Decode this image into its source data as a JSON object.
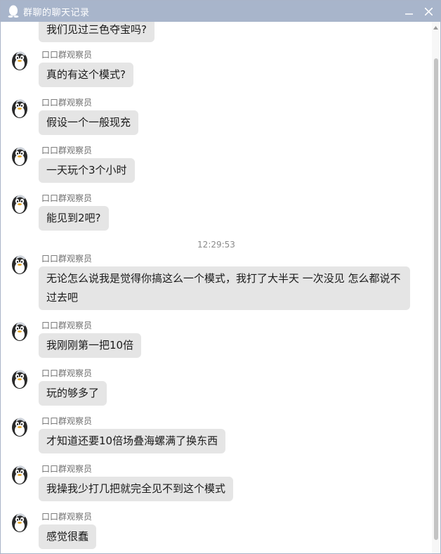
{
  "window": {
    "title": "群聊的聊天记录",
    "minimize_icon": "minimize-icon",
    "close_icon": "close-icon",
    "app_icon": "penguin-icon"
  },
  "chat": {
    "top_partial_message": "我们见过三色夺宝吗?",
    "timestamp": "12:29:53",
    "messages_before_timestamp": [
      {
        "sender": "口口群观察员",
        "text": "真的有这个模式?"
      },
      {
        "sender": "口口群观察员",
        "text": "假设一个一般现充"
      },
      {
        "sender": "口口群观察员",
        "text": "一天玩个3个小时"
      },
      {
        "sender": "口口群观察员",
        "text": "能见到2吧?"
      }
    ],
    "messages_after_timestamp": [
      {
        "sender": "口口群观察员",
        "text": "无论怎么说我是觉得你搞这么一个模式，我打了大半天 一次没见 怎么都说不过去吧"
      },
      {
        "sender": "口口群观察员",
        "text": "我刚刚第一把10倍"
      },
      {
        "sender": "口口群观察员",
        "text": "玩的够多了"
      },
      {
        "sender": "口口群观察员",
        "text": "才知道还要10倍场叠海螺满了换东西"
      },
      {
        "sender": "口口群观察员",
        "text": "我操我少打几把就完全见不到这个模式"
      },
      {
        "sender": "口口群观察员",
        "text": "感觉很蠢"
      }
    ]
  },
  "colors": {
    "titlebar": "#a8b5cb",
    "bubble": "#e5e5e5",
    "sender": "#6e6e6e"
  }
}
